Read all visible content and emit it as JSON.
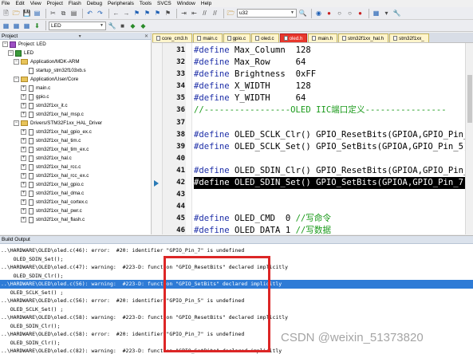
{
  "menu": [
    "File",
    "Edit",
    "View",
    "Project",
    "Flash",
    "Debug",
    "Peripherals",
    "Tools",
    "SVCS",
    "Window",
    "Help"
  ],
  "toolbar": {
    "target_combo": "u32",
    "target_select": "LED"
  },
  "project_panel": {
    "title": "Project",
    "tree": [
      {
        "label": "Project: LED",
        "level": 0,
        "expander": "-",
        "icon": "proj"
      },
      {
        "label": "LED",
        "level": 1,
        "expander": "-",
        "icon": "target"
      },
      {
        "label": "Application/MDK-ARM",
        "level": 2,
        "expander": "-",
        "icon": "folder"
      },
      {
        "label": "startup_stm32f103xb.s",
        "level": 3,
        "expander": "",
        "icon": "file"
      },
      {
        "label": "Application/User/Core",
        "level": 2,
        "expander": "-",
        "icon": "folder"
      },
      {
        "label": "main.c",
        "level": 3,
        "expander": "+",
        "icon": "file"
      },
      {
        "label": "gpio.c",
        "level": 3,
        "expander": "+",
        "icon": "file"
      },
      {
        "label": "stm32f1xx_it.c",
        "level": 3,
        "expander": "+",
        "icon": "file"
      },
      {
        "label": "stm32f1xx_hal_msp.c",
        "level": 3,
        "expander": "+",
        "icon": "file"
      },
      {
        "label": "Drivers/STM32F1xx_HAL_Driver",
        "level": 2,
        "expander": "-",
        "icon": "folder"
      },
      {
        "label": "stm32f1xx_hal_gpio_ex.c",
        "level": 3,
        "expander": "+",
        "icon": "file"
      },
      {
        "label": "stm32f1xx_hal_tim.c",
        "level": 3,
        "expander": "+",
        "icon": "file"
      },
      {
        "label": "stm32f1xx_hal_tim_ex.c",
        "level": 3,
        "expander": "+",
        "icon": "file"
      },
      {
        "label": "stm32f1xx_hal.c",
        "level": 3,
        "expander": "+",
        "icon": "file"
      },
      {
        "label": "stm32f1xx_hal_rcc.c",
        "level": 3,
        "expander": "+",
        "icon": "file"
      },
      {
        "label": "stm32f1xx_hal_rcc_ex.c",
        "level": 3,
        "expander": "+",
        "icon": "file"
      },
      {
        "label": "stm32f1xx_hal_gpio.c",
        "level": 3,
        "expander": "+",
        "icon": "file"
      },
      {
        "label": "stm32f1xx_hal_dma.c",
        "level": 3,
        "expander": "+",
        "icon": "file"
      },
      {
        "label": "stm32f1xx_hal_cortex.c",
        "level": 3,
        "expander": "+",
        "icon": "file"
      },
      {
        "label": "stm32f1xx_hal_pwr.c",
        "level": 3,
        "expander": "+",
        "icon": "file"
      },
      {
        "label": "stm32f1xx_hal_flash.c",
        "level": 3,
        "expander": "+",
        "icon": "file"
      }
    ],
    "tabs": [
      "Project",
      "Books",
      "{} Functions",
      "0→ Templates"
    ]
  },
  "editor": {
    "tabs": [
      "core_cm3.h",
      "main.c",
      "gpio.c",
      "oled.c",
      "oled.h",
      "main.h",
      "stm32f1xx_hal.h",
      "stm32f1xx_"
    ],
    "active_tab": 4,
    "lines": [
      {
        "n": "31",
        "pre": "#define",
        "rest": " Max_Column  128"
      },
      {
        "n": "32",
        "pre": "#define",
        "rest": " Max_Row     64"
      },
      {
        "n": "33",
        "pre": "#define",
        "rest": " Brightness  0xFF"
      },
      {
        "n": "34",
        "pre": "#define",
        "rest": " X_WIDTH     128"
      },
      {
        "n": "35",
        "pre": "#define",
        "rest": " Y_WIDTH     64"
      },
      {
        "n": "36",
        "comment": "//-----------------OLED IIC端口定义----------------"
      },
      {
        "n": "37"
      },
      {
        "n": "38",
        "pre": "#define",
        "rest": " OLED_SCLK_Clr() GPIO_ResetBits(GPIOA,GPIO_Pin_5)/"
      },
      {
        "n": "39",
        "pre": "#define",
        "rest": " OLED_SCLK_Set() GPIO_SetBits(GPIOA,GPIO_Pin_5)"
      },
      {
        "n": "40"
      },
      {
        "n": "41",
        "pre": "#define",
        "rest": " OLED_SDIN_Clr() GPIO_ResetBits(GPIOA,GPIO_Pin_7)/"
      },
      {
        "n": "42",
        "pre": "#define",
        "rest": " OLED_SDIN_Set() GPIO_SetBits(GPIOA,GPIO_Pin_7)",
        "highlight": true
      },
      {
        "n": "43"
      },
      {
        "n": "44"
      },
      {
        "n": "45",
        "pre": "#define",
        "rest": " OLED_CMD  0 ",
        "comment": "//写命令"
      },
      {
        "n": "46",
        "pre": "#define",
        "rest": " OLED_DATA 1 ",
        "comment": "//写数据"
      },
      {
        "n": "47"
      }
    ]
  },
  "build_output": {
    "title": "Build Output",
    "lines": [
      {
        "text": "..\\HARDWARE\\OLED\\oled.c(46): error:  #20: identifier \"GPIO_Pin_7\" is undefined"
      },
      {
        "text": "    OLED_SDIN_Set();"
      },
      {
        "text": "..\\HARDWARE\\OLED\\oled.c(47): warning:  #223-D: function \"GPIO_ResetBits\" declared implicitly"
      },
      {
        "text": "    OLED_SDIN_Clr();"
      },
      {
        "text": "..\\HARDWARE\\OLED\\oled.c(56): warning:  #223-D: function \"GPIO_SetBits\" declared implicitly",
        "selected": true
      },
      {
        "text": "   OLED_SCLK_Set() ;"
      },
      {
        "text": "..\\HARDWARE\\OLED\\oled.c(56): error:  #20: identifier \"GPIO_Pin_5\" is undefined"
      },
      {
        "text": "   OLED_SCLK_Set() ;"
      },
      {
        "text": "..\\HARDWARE\\OLED\\oled.c(58): warning:  #223-D: function \"GPIO_ResetBits\" declared implicitly"
      },
      {
        "text": "   OLED_SDIN_Clr();"
      },
      {
        "text": "..\\HARDWARE\\OLED\\oled.c(58): error:  #20: identifier \"GPIO_Pin_7\" is undefined"
      },
      {
        "text": "   OLED_SDIN_Clr();"
      },
      {
        "text": "..\\HARDWARE\\OLED\\oled.c(82): warning:  #223-D: function \"GPIO_SetBits\" declared implicitly"
      }
    ]
  },
  "watermark": "CSDN @weixin_51373820",
  "colors": {
    "active_tab": "#e8372c",
    "selected_line": "#2e7bd6",
    "highlight_box": "#dc2626",
    "keyword": "#1e2fa8",
    "comment": "#1a9a1a"
  }
}
